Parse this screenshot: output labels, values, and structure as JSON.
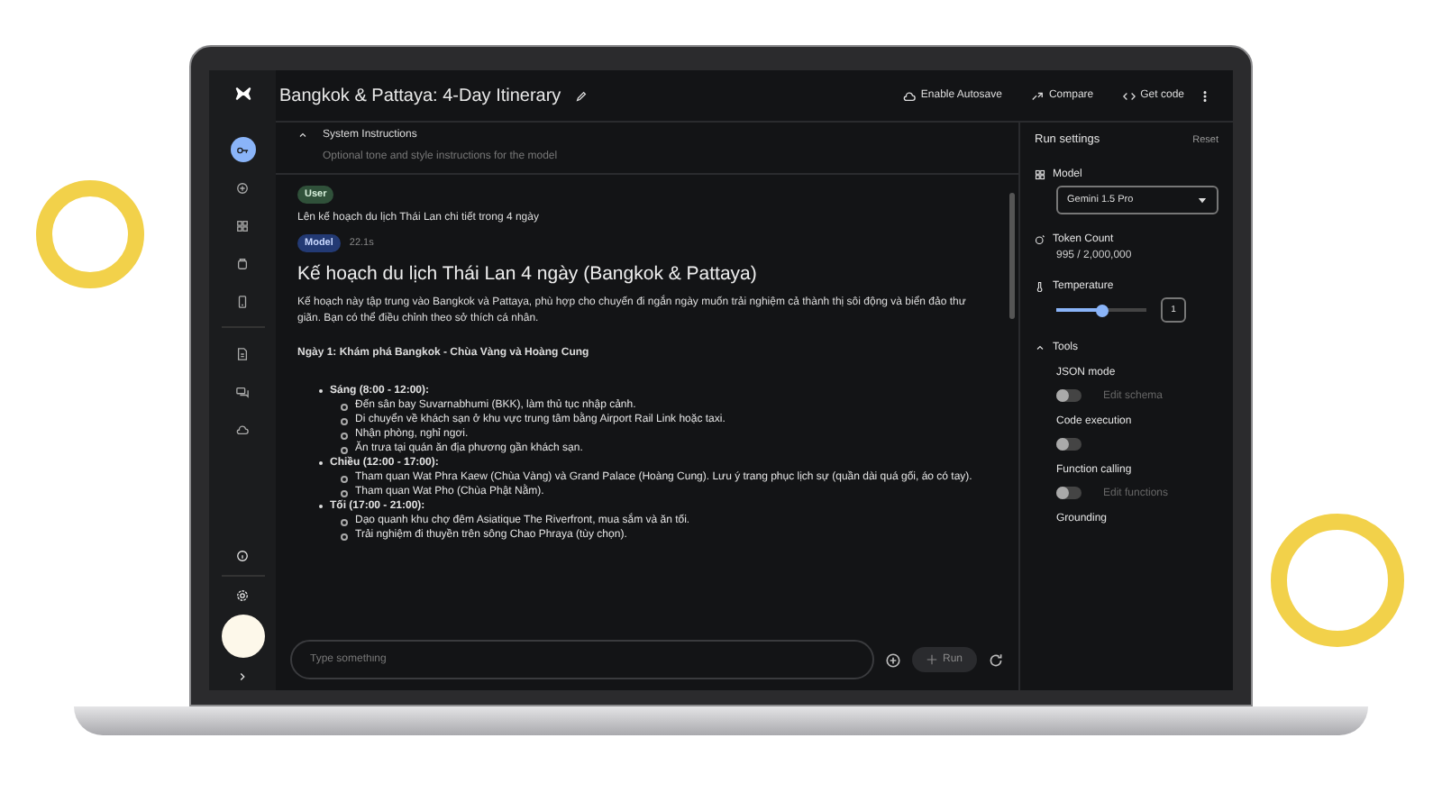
{
  "app": {
    "title": "Bangkok & Pattaya: 4-Day Itinerary",
    "actions": [
      {
        "kind": "autosave",
        "label": "Enable Autosave"
      },
      {
        "kind": "compare",
        "label": "Compare"
      },
      {
        "kind": "code",
        "label": "Get code"
      }
    ]
  },
  "rail": [
    {
      "kind": "key",
      "selected": true
    },
    {
      "kind": "plus",
      "selected": false
    },
    {
      "kind": "grid",
      "selected": false
    },
    {
      "kind": "box",
      "selected": false
    },
    {
      "kind": "phone",
      "selected": false
    },
    {
      "kind": "doc",
      "selected": false
    },
    {
      "kind": "chat",
      "selected": false
    },
    {
      "kind": "cloud",
      "selected": false
    }
  ],
  "system_instructions": {
    "title": "System Instructions",
    "expanded": true,
    "placeholder": "Optional tone and style instructions for the model"
  },
  "messages": [
    {
      "kind": "user",
      "role": "User",
      "text": "Lên kế hoạch du lịch Thái Lan chi tiết trong 4 ngày"
    },
    {
      "kind": "model",
      "role": "Model",
      "time": "22.1s",
      "heading": "Kế hoạch du lịch Thái Lan 4 ngày (Bangkok & Pattaya)",
      "intro": "Kế hoạch này tập trung vào Bangkok và Pattaya, phù hợp cho chuyến đi ngắn ngày muốn trải nghiệm cả thành thị sôi động và biển đảo thư giãn. Bạn có thể điều chỉnh theo sở thích cá nhân.",
      "day_title": "Ngày 1: Khám phá Bangkok - Chùa Vàng và Hoàng Cung",
      "sections": [
        {
          "label": "Sáng (8:00 - 12:00):",
          "items": [
            "Đến sân bay Suvarnabhumi (BKK), làm thủ tục nhập cảnh.",
            "Di chuyển về khách sạn ở khu vực trung tâm bằng Airport Rail Link hoặc taxi.",
            "Nhận phòng, nghỉ ngơi.",
            "Ăn trưa tại quán ăn địa phương gần khách sạn."
          ]
        },
        {
          "label": "Chiều (12:00 - 17:00):",
          "items": [
            "Tham quan Wat Phra Kaew (Chùa Vàng) và Grand Palace (Hoàng Cung). Lưu ý trang phục lịch sự (quần dài quá gối, áo có tay).",
            "Tham quan Wat Pho (Chùa Phật Nằm)."
          ]
        },
        {
          "label": "Tối (17:00 - 21:00):",
          "items": [
            "Dạo quanh khu chợ đêm Asiatique The Riverfront, mua sắm và ăn tối.",
            "Trải nghiệm đi thuyền trên sông Chao Phraya (tùy chọn)."
          ]
        }
      ]
    }
  ],
  "composer": {
    "placeholder": "Type something",
    "run": "Run"
  },
  "run_settings": {
    "title": "Run settings",
    "reset": "Reset",
    "model_label": "Model",
    "model": "Gemini 1.5 Pro",
    "token_label": "Token Count",
    "token_count": "995 / 2,000,000",
    "temperature_label": "Temperature",
    "temperature": {
      "level": 0.5,
      "value": "1"
    },
    "tools_title": "Tools",
    "tools_expanded": true,
    "tools": [
      {
        "name": "JSON mode",
        "on": false,
        "link": "Edit schema"
      },
      {
        "name": "Code execution",
        "on": false
      },
      {
        "name": "Function calling",
        "on": false,
        "link": "Edit functions"
      },
      {
        "name": "Grounding"
      }
    ]
  }
}
